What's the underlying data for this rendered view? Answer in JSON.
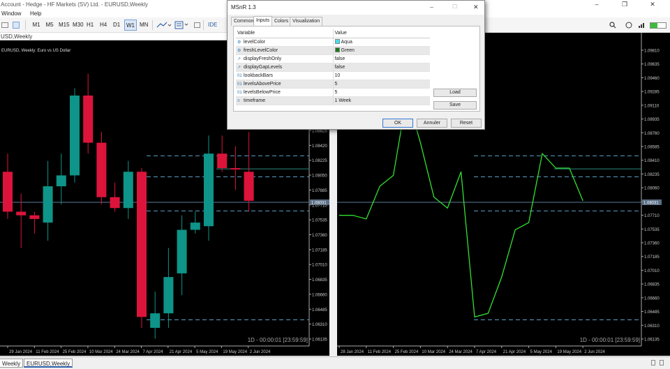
{
  "window": {
    "title": "Account - Hedge - HF Markets (SV) Ltd. - EURUSD,Weekly",
    "min": "–",
    "max": "☐",
    "close": "✕",
    "restore": "❐"
  },
  "menu": {
    "items": [
      "Window",
      "Help"
    ]
  },
  "toolbar": {
    "timeframes": [
      "M1",
      "M5",
      "M15",
      "M30",
      "H1",
      "H4",
      "D1",
      "W1",
      "MN"
    ],
    "active": "W1",
    "ide": "IDE"
  },
  "left_chart": {
    "window_label": "USD,Weekly",
    "info": "EURUSD, Weekly: Euro vs US Dollar",
    "timer": "1D - 00:00:01 [23:59:59]",
    "price_ticks": [
      "1.08825",
      "1.08420",
      "1.08225",
      "1.08050",
      "1.07885",
      "1.07710",
      "1.07535",
      "1.07360",
      "1.07185",
      "1.07010",
      "1.06835",
      "1.06660",
      "1.06485",
      "1.06310",
      "1.06135"
    ],
    "current_price": "1.08031",
    "date_ticks": [
      "29 Jan 2024",
      "11 Feb 2024",
      "25 Feb 2024",
      "10 Mar 2024",
      "24 Mar 2024",
      "7 Apr 2024",
      "21 Apr 2024",
      "5 May 2024",
      "19 May 2024",
      "2 Jun 2024"
    ]
  },
  "right_chart": {
    "timer": "1D - 00:00:01 [23:59:59]",
    "price_ticks": [
      "1.09810",
      "1.09635",
      "1.09460",
      "1.09285",
      "1.09110",
      "1.08935",
      "1.08760",
      "1.08585",
      "1.08410",
      "1.08235",
      "1.08060",
      "1.07885",
      "1.07710",
      "1.07535",
      "1.07360",
      "1.07185",
      "1.07010",
      "1.06835",
      "1.06660",
      "1.06485",
      "1.06310",
      "1.06135"
    ],
    "current_price": "1.08031",
    "date_ticks": [
      "28 Jan 2024",
      "11 Feb 2024",
      "25 Feb 2024",
      "10 Mar 2024",
      "24 Mar 2024",
      "7 Apr 2024",
      "21 Apr 2024",
      "5 May 2024",
      "19 May 2024",
      "2 Jun 2024"
    ]
  },
  "tabs": [
    "Weekly",
    "EURUSD,Weekly"
  ],
  "dialog": {
    "title": "MSnR 1.3",
    "tabs": [
      "Common",
      "Inputs",
      "Colors",
      "Visualization"
    ],
    "active_tab": "Inputs",
    "headers": {
      "variable": "Variable",
      "value": "Value"
    },
    "params": [
      {
        "icon": "color-icon",
        "glyph": "⚙",
        "name": "levelColor",
        "value": "Aqua",
        "swatch": "#40e0f0"
      },
      {
        "icon": "color-icon",
        "glyph": "⚙",
        "name": "freshLevelColor",
        "value": "Green",
        "swatch": "#1a7a1a"
      },
      {
        "icon": "bool-icon",
        "glyph": "↗",
        "name": "displayFreshOnly",
        "value": "false"
      },
      {
        "icon": "bool-icon",
        "glyph": "↗",
        "name": "displayGapLevels",
        "value": "false"
      },
      {
        "icon": "int-icon",
        "glyph": "01",
        "name": "lookbackBars",
        "value": "10"
      },
      {
        "icon": "int-icon",
        "glyph": "01",
        "name": "levelsAbovePrice",
        "value": "5"
      },
      {
        "icon": "int-icon",
        "glyph": "01",
        "name": "levelsBelowPrice",
        "value": "5"
      },
      {
        "icon": "enum-icon",
        "glyph": "≡",
        "name": "timeframe",
        "value": "1 Week"
      }
    ],
    "load": "Load",
    "save": "Save",
    "ok": "OK",
    "cancel": "Annuler",
    "reset": "Reset"
  },
  "colors": {
    "bull": "#0e9488",
    "bear": "#dc143c",
    "line": "#32e032",
    "level": "#5aa0c8",
    "price_line": "#5a7d9a"
  },
  "chart_data": [
    {
      "type": "candlestick",
      "title": "EURUSD, Weekly: Euro vs US Dollar",
      "ylim": [
        1.0605,
        1.0998
      ],
      "candles": [
        {
          "o": 1.0845,
          "h": 1.087,
          "l": 1.078,
          "c": 1.079,
          "dir": "bear"
        },
        {
          "o": 1.079,
          "h": 1.0815,
          "l": 1.074,
          "c": 1.0785,
          "dir": "bear"
        },
        {
          "o": 1.0785,
          "h": 1.079,
          "l": 1.076,
          "c": 1.078,
          "dir": "bear"
        },
        {
          "o": 1.0775,
          "h": 1.086,
          "l": 1.075,
          "c": 1.0825,
          "dir": "bull"
        },
        {
          "o": 1.0825,
          "h": 1.087,
          "l": 1.08,
          "c": 1.084,
          "dir": "bull"
        },
        {
          "o": 1.084,
          "h": 1.096,
          "l": 1.083,
          "c": 1.095,
          "dir": "bull"
        },
        {
          "o": 1.095,
          "h": 1.098,
          "l": 1.087,
          "c": 1.0885,
          "dir": "bear"
        },
        {
          "o": 1.0885,
          "h": 1.09,
          "l": 1.08,
          "c": 1.081,
          "dir": "bear"
        },
        {
          "o": 1.081,
          "h": 1.083,
          "l": 1.079,
          "c": 1.0795,
          "dir": "bear"
        },
        {
          "o": 1.0795,
          "h": 1.086,
          "l": 1.078,
          "c": 1.0845,
          "dir": "bull"
        },
        {
          "o": 1.0845,
          "h": 1.085,
          "l": 1.063,
          "c": 1.0645,
          "dir": "bear"
        },
        {
          "o": 1.063,
          "h": 1.068,
          "l": 1.0615,
          "c": 1.065,
          "dir": "bull"
        },
        {
          "o": 1.065,
          "h": 1.074,
          "l": 1.063,
          "c": 1.07,
          "dir": "bull"
        },
        {
          "o": 1.0705,
          "h": 1.0785,
          "l": 1.0675,
          "c": 1.0765,
          "dir": "bull"
        },
        {
          "o": 1.0765,
          "h": 1.079,
          "l": 1.076,
          "c": 1.0775,
          "dir": "bull"
        },
        {
          "o": 1.077,
          "h": 1.0895,
          "l": 1.075,
          "c": 1.087,
          "dir": "bull"
        },
        {
          "o": 1.087,
          "h": 1.0895,
          "l": 1.0845,
          "c": 1.085,
          "dir": "bear"
        },
        {
          "o": 1.085,
          "h": 1.088,
          "l": 1.082,
          "c": 1.085,
          "dir": "bear"
        },
        {
          "o": 1.0845,
          "h": 1.09,
          "l": 1.079,
          "c": 1.0805,
          "dir": "bear"
        }
      ],
      "levels_dashed": [
        1.0867,
        1.0838,
        1.0791,
        1.0641
      ],
      "levels_solid": [
        1.0849
      ],
      "current_price": 1.0803
    },
    {
      "type": "line",
      "ylim": [
        1.0605,
        1.0998
      ],
      "series": [
        {
          "values": [
            1.0785,
            1.0785,
            1.078,
            1.0825,
            1.084,
            1.095,
            1.0885,
            1.081,
            1.0795,
            1.0845,
            1.0645,
            1.065,
            1.07,
            1.0765,
            1.0775,
            1.087,
            1.085,
            1.085,
            1.0805
          ]
        }
      ],
      "levels_dashed": [
        1.0867,
        1.0838,
        1.0791,
        1.0641
      ],
      "levels_solid": [
        1.0849
      ],
      "current_price": 1.0803
    }
  ]
}
